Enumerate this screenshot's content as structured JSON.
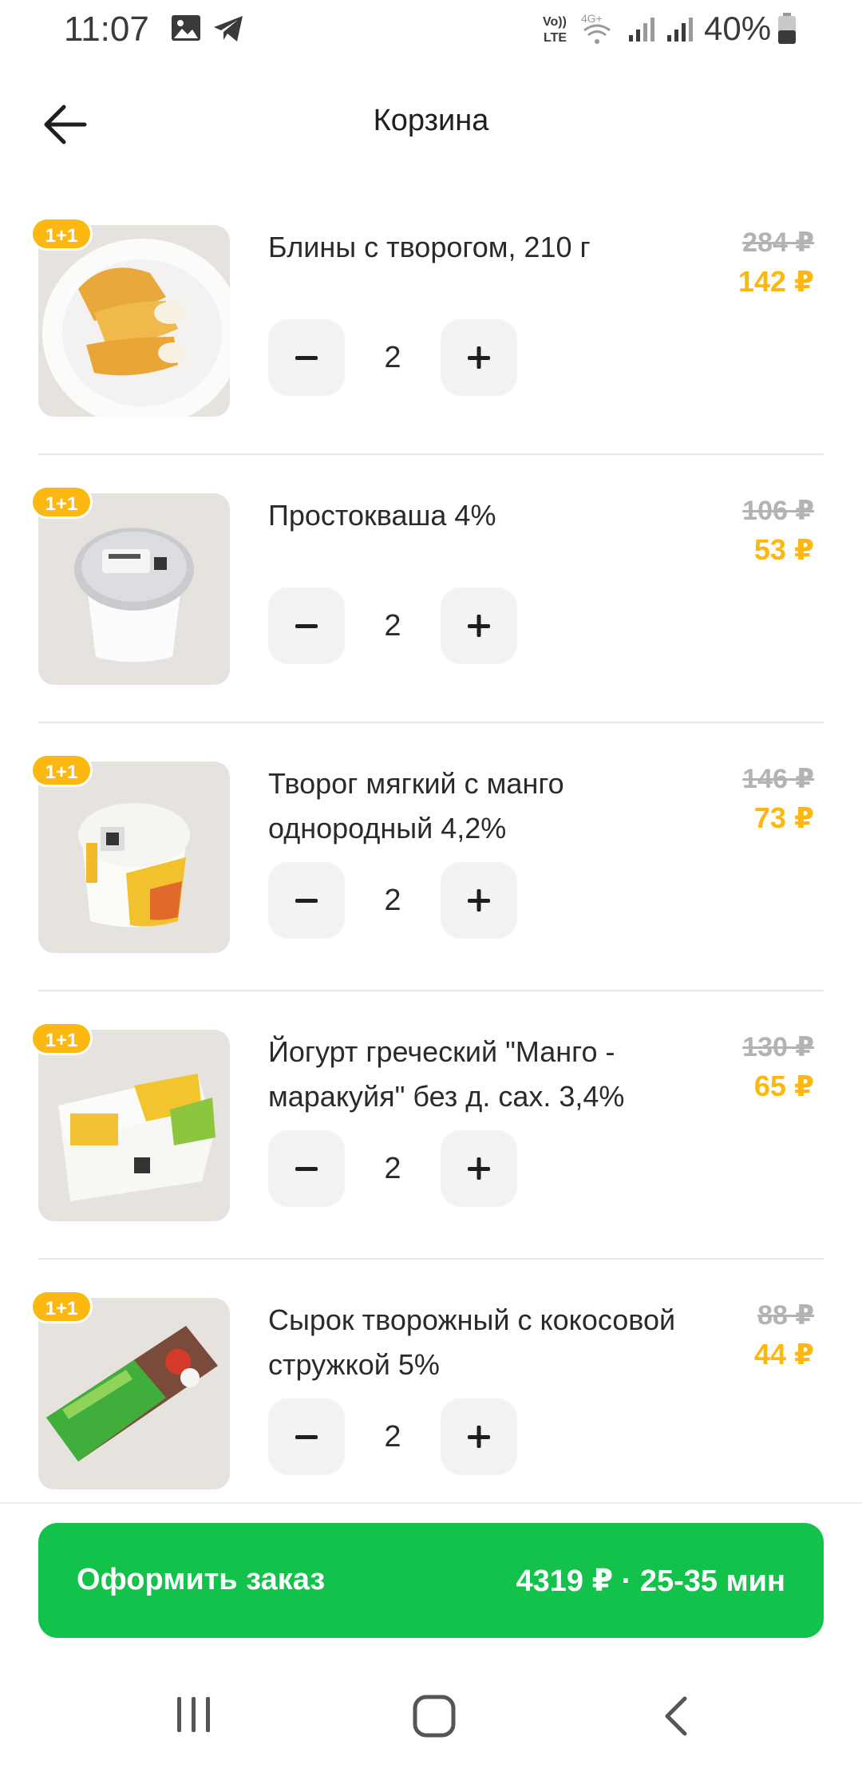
{
  "status_bar": {
    "time": "11:07",
    "battery": "40%",
    "volte_label_top": "Vo))",
    "volte_label_bottom": "LTE",
    "network_label": "4G+"
  },
  "header": {
    "title": "Корзина",
    "back_icon": "arrow-left-icon"
  },
  "colors": {
    "accent_green": "#12c24b",
    "promo_yellow": "#fcb711",
    "old_price_gray": "#b3b3b3"
  },
  "cart": {
    "items": [
      {
        "badge": "1+1",
        "name": "Блины с творогом, 210 г",
        "old_price": "284 ₽",
        "new_price": "142 ₽",
        "quantity": "2",
        "image": "crepes-photo"
      },
      {
        "badge": "1+1",
        "name": "Простокваша 4%",
        "old_price": "106 ₽",
        "new_price": "53 ₽",
        "quantity": "2",
        "image": "prostokvasha-cup-photo"
      },
      {
        "badge": "1+1",
        "name": "Творог мягкий с манго однородный 4,2%",
        "old_price": "146 ₽",
        "new_price": "73 ₽",
        "quantity": "2",
        "image": "mango-curd-cup-photo"
      },
      {
        "badge": "1+1",
        "name": "Йогурт греческий \"Манго - маракуйя\" без д. сах. 3,4%",
        "old_price": "130 ₽",
        "new_price": "65 ₽",
        "quantity": "2",
        "image": "greek-yogurt-photo"
      },
      {
        "badge": "1+1",
        "name": "Сырок творожный с кокосовой стружкой 5%",
        "old_price": "88 ₽",
        "new_price": "44 ₽",
        "quantity": "2",
        "image": "curd-bar-photo"
      }
    ]
  },
  "checkout": {
    "label": "Оформить заказ",
    "summary": "4319 ₽ · 25-35 мин"
  },
  "nav_bar": {
    "icons": [
      "recent-apps-icon",
      "home-icon",
      "back-icon"
    ]
  }
}
